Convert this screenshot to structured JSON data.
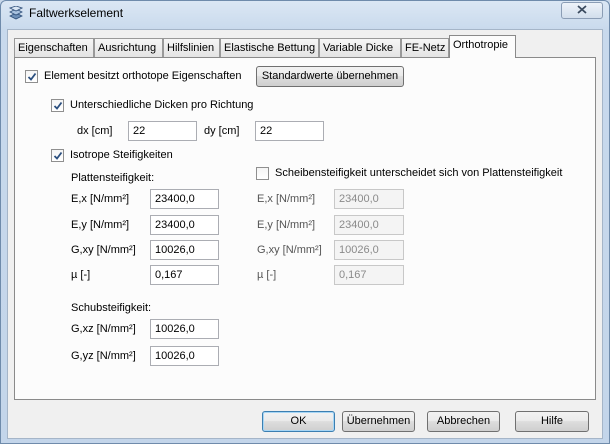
{
  "window": {
    "title": "Faltwerkselement"
  },
  "tabs": [
    {
      "label": "Eigenschaften"
    },
    {
      "label": "Ausrichtung"
    },
    {
      "label": "Hilfslinien"
    },
    {
      "label": "Elastische Bettung"
    },
    {
      "label": "Variable Dicke"
    },
    {
      "label": "FE-Netz"
    },
    {
      "label": "Orthotropie"
    }
  ],
  "active_tab": "Orthotropie",
  "ortho": {
    "element_cb": {
      "label": "Element besitzt orthotope Eigenschaften",
      "checked": true
    },
    "defaults_button": "Standardwerte übernehmen",
    "thickness_cb": {
      "label": "Unterschiedliche Dicken pro Richtung",
      "checked": true
    },
    "dx": {
      "label": "dx [cm]",
      "value": "22"
    },
    "dy": {
      "label": "dy [cm]",
      "value": "22"
    },
    "isotrop_cb": {
      "label": "Isotrope Steifigkeiten",
      "checked": true
    },
    "plate": {
      "heading": "Plattensteifigkeit:",
      "ex": {
        "label": "E,x [N/mm²]",
        "value": "23400,0"
      },
      "ey": {
        "label": "E,y [N/mm²]",
        "value": "23400,0"
      },
      "gxy": {
        "label": "G,xy [N/mm²]",
        "value": "10026,0"
      },
      "mu": {
        "label": "µ [-]",
        "value": "0,167"
      }
    },
    "disc_cb": {
      "label": "Scheibensteifigkeit unterscheidet sich von Plattensteifigkeit",
      "checked": false
    },
    "disc": {
      "ex": {
        "label": "E,x [N/mm²]",
        "value": "23400,0"
      },
      "ey": {
        "label": "E,y [N/mm²]",
        "value": "23400,0"
      },
      "gxy": {
        "label": "G,xy [N/mm²]",
        "value": "10026,0"
      },
      "mu": {
        "label": "µ [-]",
        "value": "0,167"
      }
    },
    "shear": {
      "heading": "Schubsteifigkeit:",
      "gxz": {
        "label": "G,xz [N/mm²]",
        "value": "10026,0"
      },
      "gyz": {
        "label": "G,yz [N/mm²]",
        "value": "10026,0"
      }
    }
  },
  "buttons": {
    "ok": "OK",
    "apply": "Übernehmen",
    "cancel": "Abbrechen",
    "help": "Hilfe"
  },
  "colors": {
    "accent": "#3c7fb1",
    "check": "#2b4f7f",
    "icon": "#4a6f9a"
  }
}
